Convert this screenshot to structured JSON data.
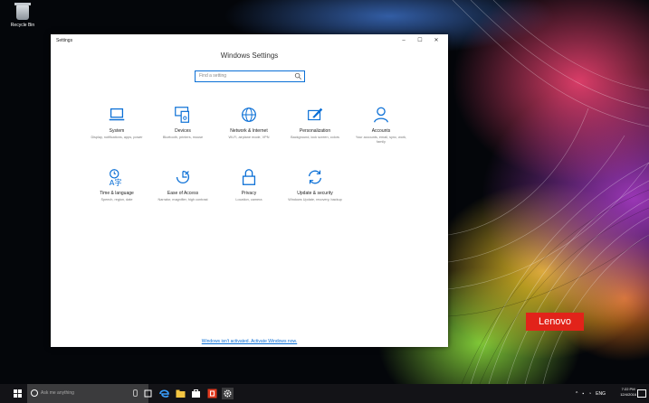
{
  "desktop": {
    "recycle_bin_label": "Recycle Bin",
    "brand_badge": "Lenovo",
    "brand_color": "#e2231a"
  },
  "window": {
    "title": "Settings",
    "controls": [
      "–",
      "☐",
      "✕"
    ],
    "heading": "Windows Settings",
    "search_placeholder": "Find a setting",
    "accent": "#0a6fd6",
    "tiles": [
      {
        "name": "System",
        "desc": "Display, notifications, apps, power",
        "icon": "laptop-icon"
      },
      {
        "name": "Devices",
        "desc": "Bluetooth, printers, mouse",
        "icon": "devices-icon"
      },
      {
        "name": "Network & Internet",
        "desc": "Wi-Fi, airplane mode, VPN",
        "icon": "globe-icon"
      },
      {
        "name": "Personalization",
        "desc": "Background, lock screen, colors",
        "icon": "brush-icon"
      },
      {
        "name": "Accounts",
        "desc": "Your accounts, email, sync, work, family",
        "icon": "person-icon"
      },
      {
        "name": "Time & language",
        "desc": "Speech, region, date",
        "icon": "clock-language-icon"
      },
      {
        "name": "Ease of Access",
        "desc": "Narrator, magnifier, high contrast",
        "icon": "ease-of-access-icon"
      },
      {
        "name": "Privacy",
        "desc": "Location, camera",
        "icon": "lock-icon"
      },
      {
        "name": "Update & security",
        "desc": "Windows Update, recovery, backup",
        "icon": "sync-icon"
      }
    ],
    "activation_link": "Windows isn't activated. Activate Windows now."
  },
  "taskbar": {
    "search_placeholder": "Ask me anything",
    "pinned": [
      "task-view-icon",
      "edge-icon",
      "file-explorer-icon",
      "store-icon",
      "office-icon",
      "settings-icon"
    ],
    "tray_icons": [
      "^",
      "▪",
      "◔",
      "ENG"
    ],
    "time": "7:22 PM",
    "date": "12/4/2016"
  }
}
